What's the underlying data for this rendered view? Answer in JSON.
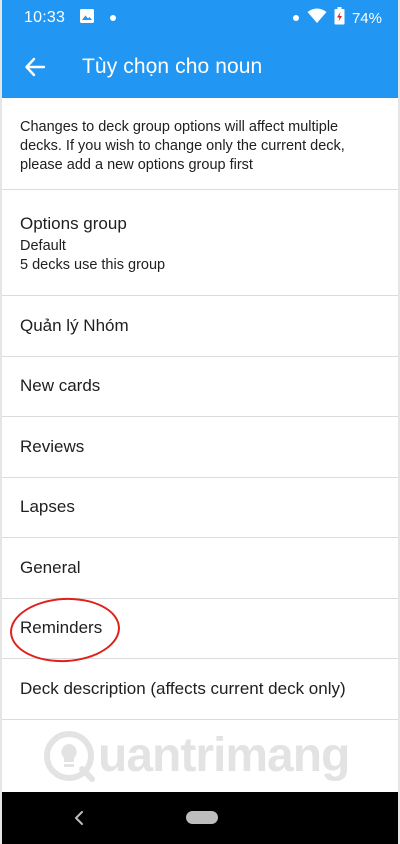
{
  "status_bar": {
    "time": "10:33",
    "battery": "74%",
    "icons": [
      "image-icon",
      "dot-icon",
      "wifi-icon",
      "battery-icon"
    ]
  },
  "toolbar": {
    "title": "Tùy chọn cho noun",
    "back_icon": "arrow-left-icon"
  },
  "info": {
    "text": "Changes to deck group options will affect multiple decks. If you wish to change only the current deck, please add a new options group first"
  },
  "options_group": {
    "title": "Options group",
    "value": "Default",
    "usage": "5 decks use this group"
  },
  "items": [
    {
      "label": "Quản lý Nhóm"
    },
    {
      "label": "New cards"
    },
    {
      "label": "Reviews"
    },
    {
      "label": "Lapses"
    },
    {
      "label": "General"
    },
    {
      "label": "Reminders"
    },
    {
      "label": "Deck description (affects current deck only)"
    }
  ],
  "watermark": {
    "text": "uantrimang"
  },
  "colors": {
    "primary": "#2196f3",
    "highlight": "#e0201b",
    "nav_bar": "#000000"
  }
}
